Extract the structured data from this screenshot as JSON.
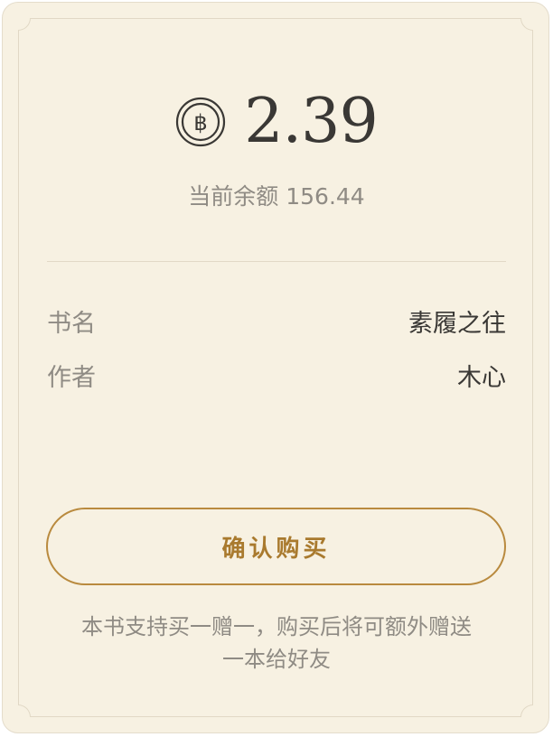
{
  "purchase": {
    "price": "2.39",
    "balance_text": "当前余额 156.44",
    "currency_icon": "coin-icon",
    "details": [
      {
        "label": "书名",
        "value": "素履之往"
      },
      {
        "label": "作者",
        "value": "木心"
      }
    ],
    "confirm_label": "确认购买",
    "note_line1": "本书支持买一赠一，购买后将可额外赠送",
    "note_line2": "一本给好友"
  },
  "colors": {
    "background": "#f7f1e2",
    "accent": "#b98a3e",
    "primary_text": "#3a3835",
    "secondary_text": "#8f8b84"
  }
}
